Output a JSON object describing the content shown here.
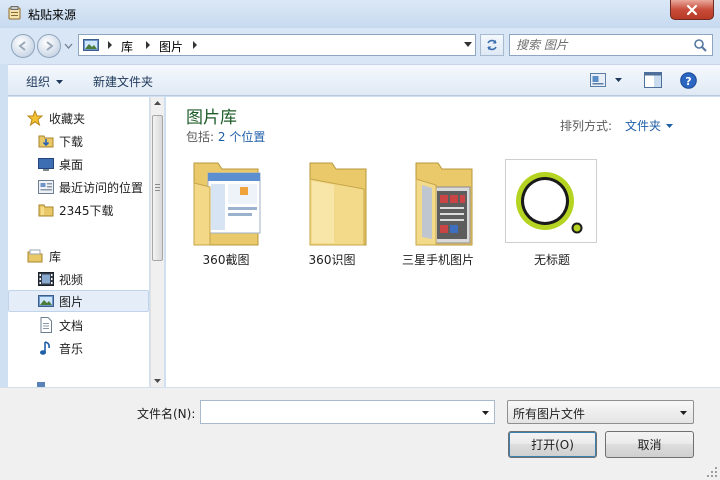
{
  "window": {
    "title": "粘贴来源",
    "close_icon": "close-icon"
  },
  "address_bar": {
    "breadcrumbs": [
      "库",
      "图片"
    ]
  },
  "search": {
    "placeholder": "搜索 图片"
  },
  "toolbar": {
    "organize_label": "组织",
    "new_folder_label": "新建文件夹"
  },
  "nav_pane": {
    "items": [
      {
        "label": "收藏夹",
        "icon": "star-icon",
        "group": true
      },
      {
        "label": "下载",
        "icon": "download-folder-icon"
      },
      {
        "label": "桌面",
        "icon": "desktop-icon"
      },
      {
        "label": "最近访问的位置",
        "icon": "recent-places-icon"
      },
      {
        "label": "2345下载",
        "icon": "folder-icon"
      },
      {
        "label": "库",
        "icon": "library-icon",
        "group": true
      },
      {
        "label": "视频",
        "icon": "video-icon"
      },
      {
        "label": "图片",
        "icon": "picture-icon",
        "selected": true
      },
      {
        "label": "文档",
        "icon": "document-icon"
      },
      {
        "label": "音乐",
        "icon": "music-icon"
      }
    ]
  },
  "main": {
    "library_title": "图片库",
    "includes_label": "包括:",
    "includes_link": "2 个位置",
    "sort_label": "排列方式:",
    "sort_value": "文件夹",
    "items": [
      {
        "label": "360截图",
        "icon": "folder-screenshot-icon"
      },
      {
        "label": "360识图",
        "icon": "folder-icon"
      },
      {
        "label": "三星手机图片",
        "icon": "folder-photo-icon"
      },
      {
        "label": "无标题",
        "icon": "image-thumbnail-icon"
      }
    ]
  },
  "bottom": {
    "filename_label": "文件名(N):",
    "filename_value": "",
    "filter_value": "所有图片文件",
    "open_label": "打开(O)",
    "cancel_label": "取消"
  },
  "colors": {
    "frame": "#cfe0f3",
    "title_green": "#1e5d2a",
    "link_blue": "#1f5fa8",
    "close_red": "#c94d3a",
    "thumb_ring": "#b5d321"
  }
}
